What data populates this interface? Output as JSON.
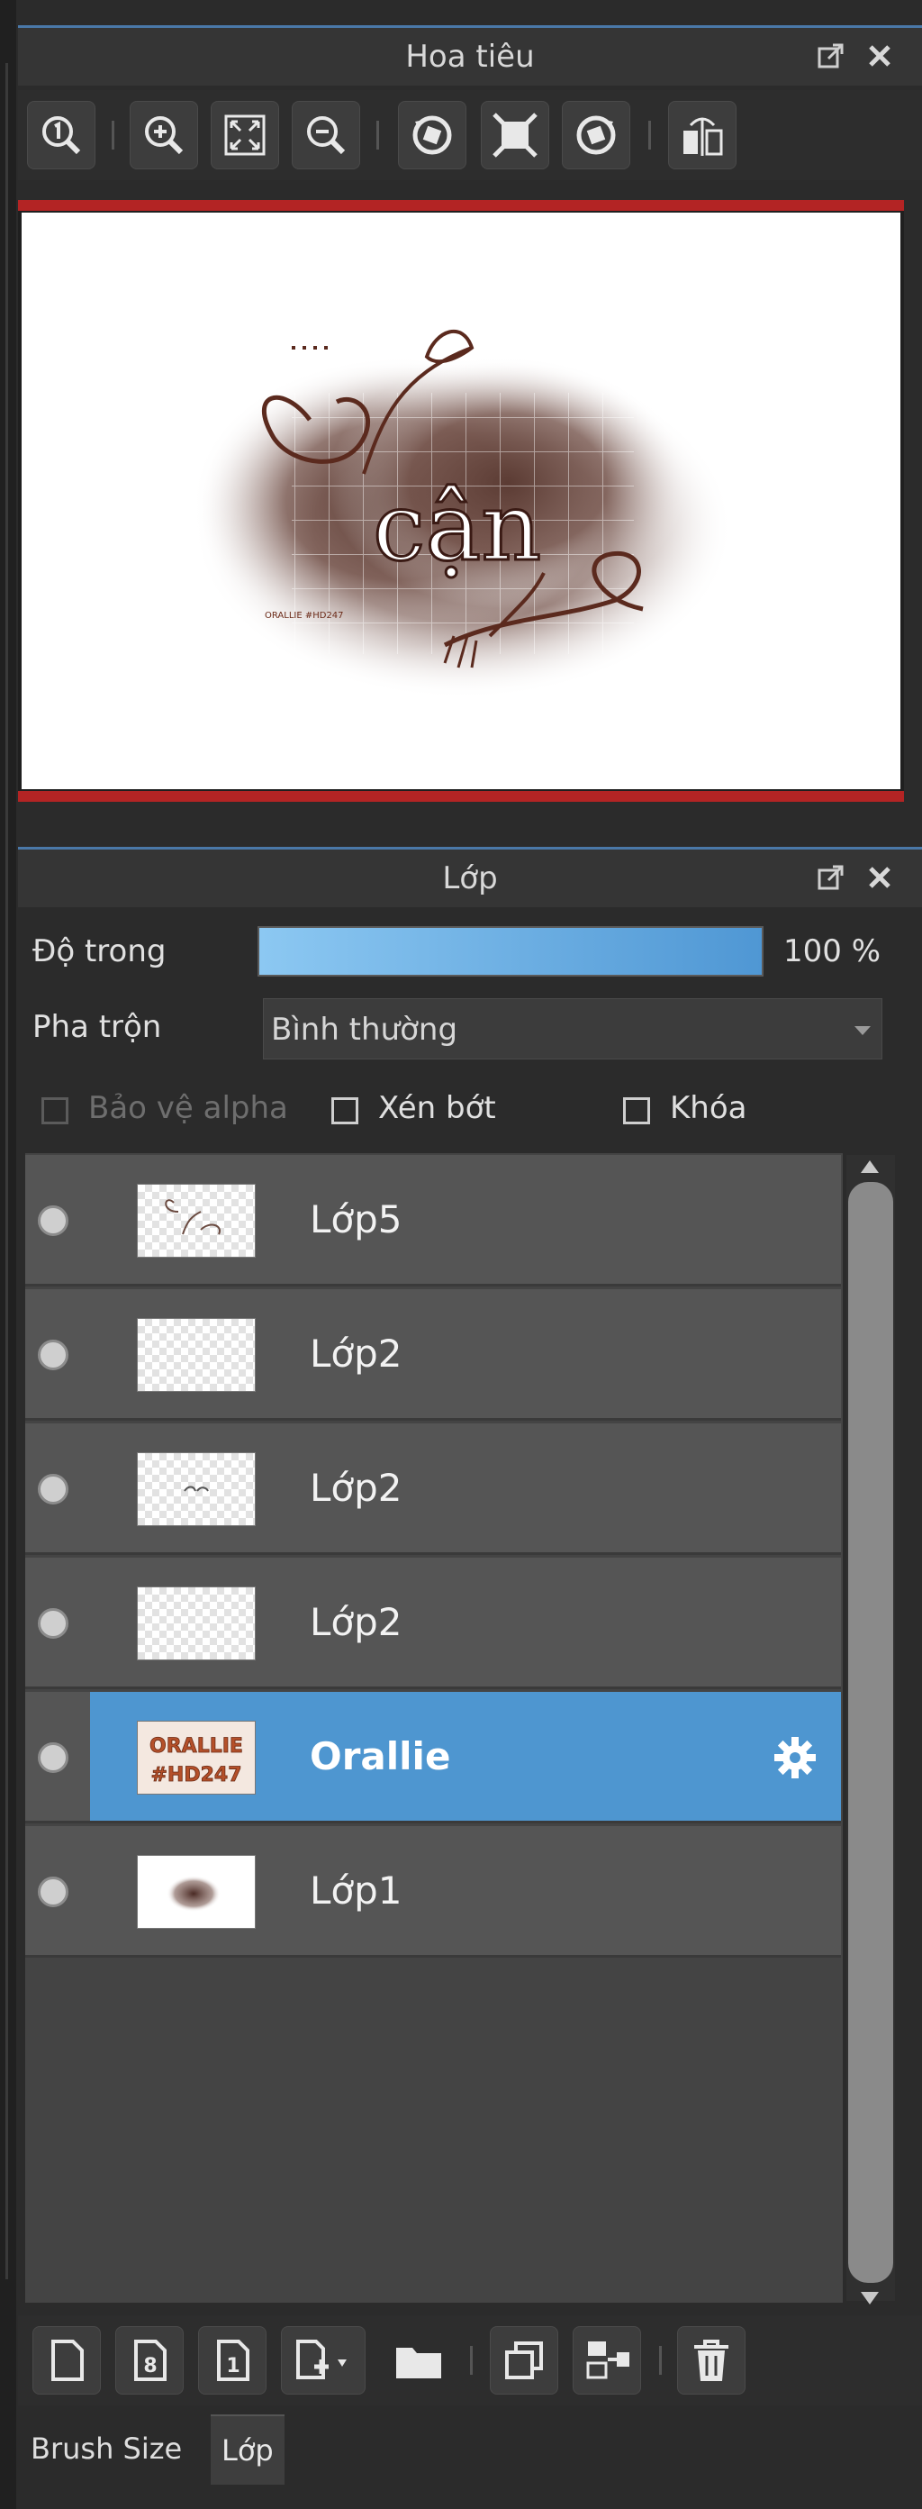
{
  "navigator": {
    "title": "Hoa tiêu",
    "toolbar_icons": [
      "zoom-actual-icon",
      "zoom-in-icon",
      "fit-screen-icon",
      "zoom-out-icon",
      "rotate-left-icon",
      "fullscreen-icon",
      "rotate-right-icon",
      "flip-horizontal-icon"
    ],
    "preview": {
      "artwork_text": "cận",
      "signature_text": "ORALLIE #HD247"
    }
  },
  "layers_panel": {
    "title": "Lớp",
    "opacity": {
      "label": "Độ trong",
      "value_text": "100 %",
      "value": 100
    },
    "blend": {
      "label": "Pha trộn",
      "value": "Bình thường"
    },
    "options": {
      "protect_alpha": {
        "label": "Bảo vệ alpha",
        "checked": false,
        "enabled": false
      },
      "clip": {
        "label": "Xén bớt",
        "checked": false
      },
      "lock": {
        "label": "Khóa",
        "checked": false
      }
    },
    "layers": [
      {
        "name": "Lớp5",
        "visible": true,
        "selected": false,
        "thumb": "sketch"
      },
      {
        "name": "Lớp2",
        "visible": true,
        "selected": false,
        "thumb": "empty"
      },
      {
        "name": "Lớp2",
        "visible": true,
        "selected": false,
        "thumb": "text"
      },
      {
        "name": "Lớp2",
        "visible": true,
        "selected": false,
        "thumb": "empty"
      },
      {
        "name": "Orallie",
        "visible": true,
        "selected": true,
        "thumb": "logo",
        "thumb_text": "ORALLIE #HD247"
      },
      {
        "name": "Lớp1",
        "visible": true,
        "selected": false,
        "thumb": "blob"
      }
    ],
    "bottom_toolbar_icons": [
      "new-layer-icon",
      "new-8bit-layer-icon",
      "new-1bit-layer-icon",
      "add-layer-menu-icon",
      "folder-icon",
      "duplicate-layer-icon",
      "merge-down-icon",
      "delete-layer-icon"
    ]
  },
  "tabs": [
    {
      "label": "Brush Size",
      "active": false
    },
    {
      "label": "Lớp",
      "active": true
    }
  ],
  "colors": {
    "accent": "#4e96d0",
    "frame_red": "#b32424",
    "panel": "#2b2b2b"
  }
}
